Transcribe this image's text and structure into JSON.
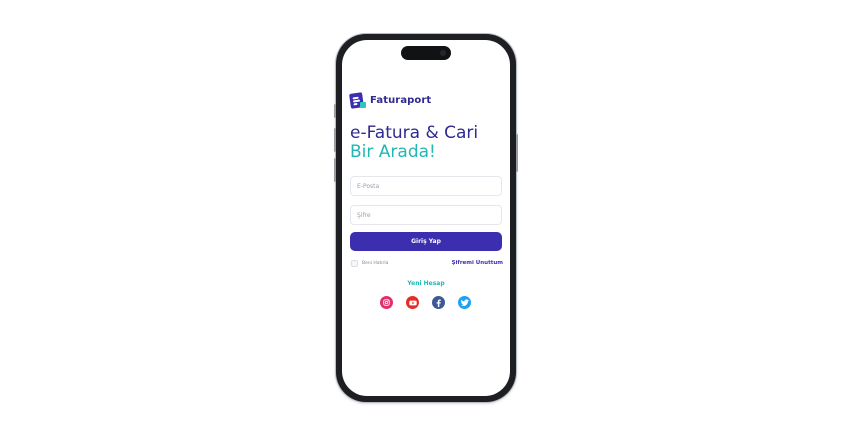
{
  "brand": {
    "name": "Faturaport"
  },
  "headline": {
    "line1": "e-Fatura & Cari",
    "line2": "Bir Arada!"
  },
  "form": {
    "email_placeholder": "E-Posta",
    "email_value": "",
    "password_placeholder": "Şifre",
    "password_value": "",
    "login_label": "Giriş Yap",
    "remember_label": "Beni Hatırla",
    "forgot_label": "Şifremi Unuttum",
    "new_account_label": "Yeni Hesap"
  },
  "social": [
    {
      "icon": "instagram-icon",
      "color": "#e1306c"
    },
    {
      "icon": "youtube-icon",
      "color": "#e52d27"
    },
    {
      "icon": "facebook-icon",
      "color": "#3b5998"
    },
    {
      "icon": "twitter-icon",
      "color": "#1da1f2"
    }
  ],
  "colors": {
    "primary": "#3b2fb0",
    "accent": "#22b7b3"
  }
}
